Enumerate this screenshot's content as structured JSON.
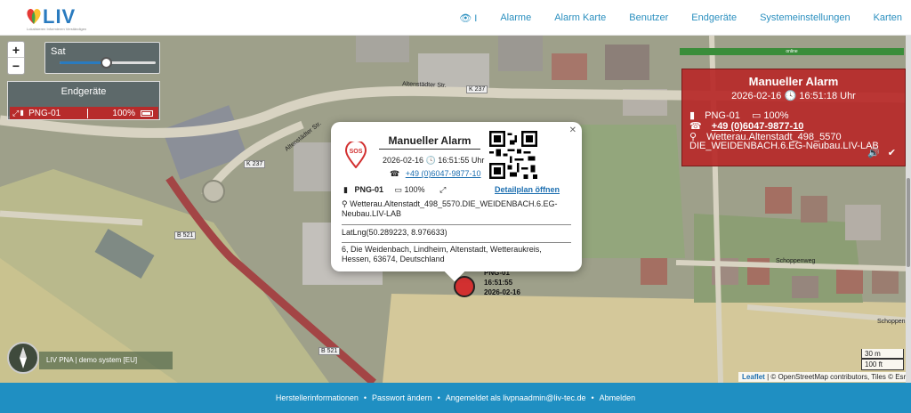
{
  "header": {
    "logo_text": "LIV",
    "logo_tagline": "Lokalisieren Informieren Verständigen",
    "nav": [
      "Alarme",
      "Alarm Karte",
      "Benutzer",
      "Endgeräte",
      "Systemeinstellungen",
      "Karten"
    ],
    "eye_suffix": "I"
  },
  "map": {
    "layer_label": "Sat",
    "layer_opacity_fraction": 0.48,
    "devices_title": "Endgeräte",
    "device": {
      "name": "PNG-01",
      "battery": "100%"
    },
    "green_bar_text": "online",
    "labels": {
      "street1": "Altenstädter Str.",
      "street2": "Altenstädter Str.",
      "k237a": "K 237",
      "k237b": "K 237",
      "b521a": "B 521",
      "b521b": "B 521",
      "schoppenweg": "Schoppenweg",
      "schoppen": "Schoppen"
    },
    "system_info": "LIV PNA | demo system [EU]",
    "scale": [
      "30 m",
      "100 ft"
    ],
    "attribution_link": "Leaflet",
    "attribution_rest": "| © OpenStreetMap contributors, Tiles © Esri"
  },
  "alarm_box": {
    "title": "Manueller Alarm",
    "date": "2026-02-16",
    "time": "16:51:18 Uhr",
    "device": "PNG-01",
    "battery": "100%",
    "phone": "+49 (0)6047-9877-10",
    "address_line1": "Wetterau.Altenstadt_498_5570",
    "address_line2": "DIE_WEIDENBACH.6.EG-Neubau.LIV-LAB"
  },
  "popup": {
    "title": "Manueller Alarm",
    "date": "2026-02-16",
    "time": "16:51:55 Uhr",
    "phone": "+49 (0)6047-9877-10",
    "device": "PNG-01",
    "battery": "100%",
    "detail_link": "Detailplan öffnen",
    "address": "Wetterau.Altenstadt_498_5570.DIE_WEIDENBACH.6.EG-Neubau.LIV-LAB",
    "latlng": "LatLng(50.289223, 8.976633)",
    "address_full": "6, Die Weidenbach, Lindheim, Altenstadt, Wetteraukreis, Hessen, 63674, Deutschland",
    "sos_label": "SOS"
  },
  "marker": {
    "line1": "PNG-01",
    "line2": "16:51:55",
    "line3": "2026-02-16"
  },
  "footer": {
    "items": [
      "Herstellerinformationen",
      "Passwort ändern",
      "Angemeldet als livpnaadmin@liv-tec.de",
      "Abmelden"
    ]
  }
}
